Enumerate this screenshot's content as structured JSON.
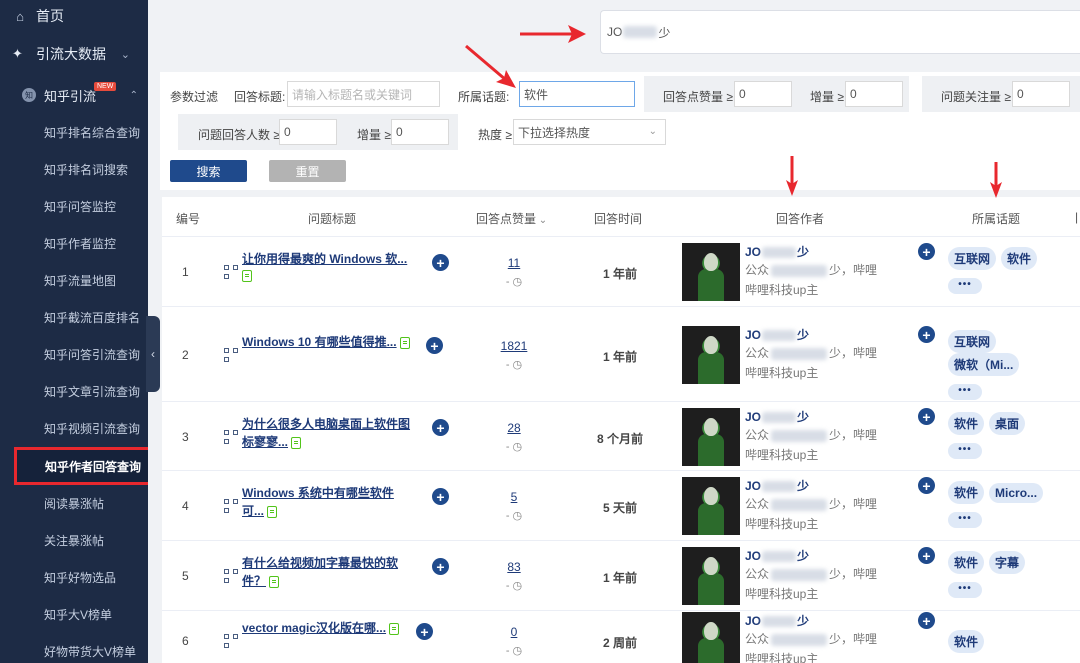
{
  "sidebar": {
    "home": "首页",
    "group1": "引流大数据",
    "sub": "知乎引流",
    "sub_badge": "NEW",
    "sub_icon": "知",
    "items": [
      "知乎排名综合查询",
      "知乎排名词搜索",
      "知乎问答监控",
      "知乎作者监控",
      "知乎流量地图",
      "知乎截流百度排名",
      "知乎问答引流查询",
      "知乎文章引流查询",
      "知乎视频引流查询",
      "知乎作者回答查询",
      "阅读暴涨帖",
      "关注暴涨帖",
      "知乎好物选品",
      "知乎大V榜单",
      "好物带货大V榜单"
    ],
    "active_index": 9,
    "collapse_glyph": "‹"
  },
  "top_name": {
    "prefix": "JO",
    "suffix": "少"
  },
  "filter": {
    "label_params": "参数过滤",
    "label_title": "回答标题:",
    "title_placeholder": "请输入标题名或关键词",
    "label_topic": "所属话题:",
    "topic_value": "软件",
    "label_votes": "回答点赞量 ≥",
    "votes_value": "0",
    "label_inc1": "增量 ≥",
    "inc1_value": "0",
    "label_follow": "问题关注量 ≥",
    "follow_value": "0",
    "label_answers": "问题回答人数 ≥",
    "answers_value": "0",
    "label_inc2": "增量 ≥",
    "inc2_value": "0",
    "label_heat": "热度 ≥",
    "heat_placeholder": "下拉选择热度",
    "search_btn": "搜索",
    "reset_btn": "重置"
  },
  "table": {
    "headers": {
      "num": "编号",
      "title": "问题标题",
      "votes": "回答点赞量",
      "time": "回答时间",
      "author": "回答作者",
      "topic": "所属话题"
    },
    "author_name_prefix": "JO",
    "author_name_suffix": "少",
    "author_desc1_prefix": "公众",
    "author_desc1_suffix": "少，哔哩",
    "author_desc2": "哔哩科技up主",
    "more": "•••",
    "rows": [
      {
        "num": "1",
        "title": "让你用得最爽的 Windows 软...",
        "votes": "11",
        "votes_sub": "- ◷",
        "time": "1 年前",
        "tags": [
          "互联网",
          "软件"
        ]
      },
      {
        "num": "2",
        "title": "Windows 10 有哪些值得推...",
        "votes": "1821",
        "votes_sub": "- ◷",
        "time": "1 年前",
        "tags": [
          "互联网",
          "微软（Mi..."
        ]
      },
      {
        "num": "3",
        "title": "为什么很多人电脑桌面上软件图标寥寥...",
        "votes": "28",
        "votes_sub": "- ◷",
        "time": "8 个月前",
        "tags": [
          "软件",
          "桌面"
        ]
      },
      {
        "num": "4",
        "title": "Windows 系统中有哪些软件可...",
        "votes": "5",
        "votes_sub": "- ◷",
        "time": "5 天前",
        "tags": [
          "软件",
          "Micro..."
        ]
      },
      {
        "num": "5",
        "title": "有什么给视频加字幕最快的软件？",
        "votes": "83",
        "votes_sub": "- ◷",
        "time": "1 年前",
        "tags": [
          "软件",
          "字幕"
        ]
      },
      {
        "num": "6",
        "title": "vector magic汉化版在哪...",
        "votes": "0",
        "votes_sub": "- ◷",
        "time": "2 周前",
        "tags": [
          "软件"
        ]
      }
    ]
  }
}
